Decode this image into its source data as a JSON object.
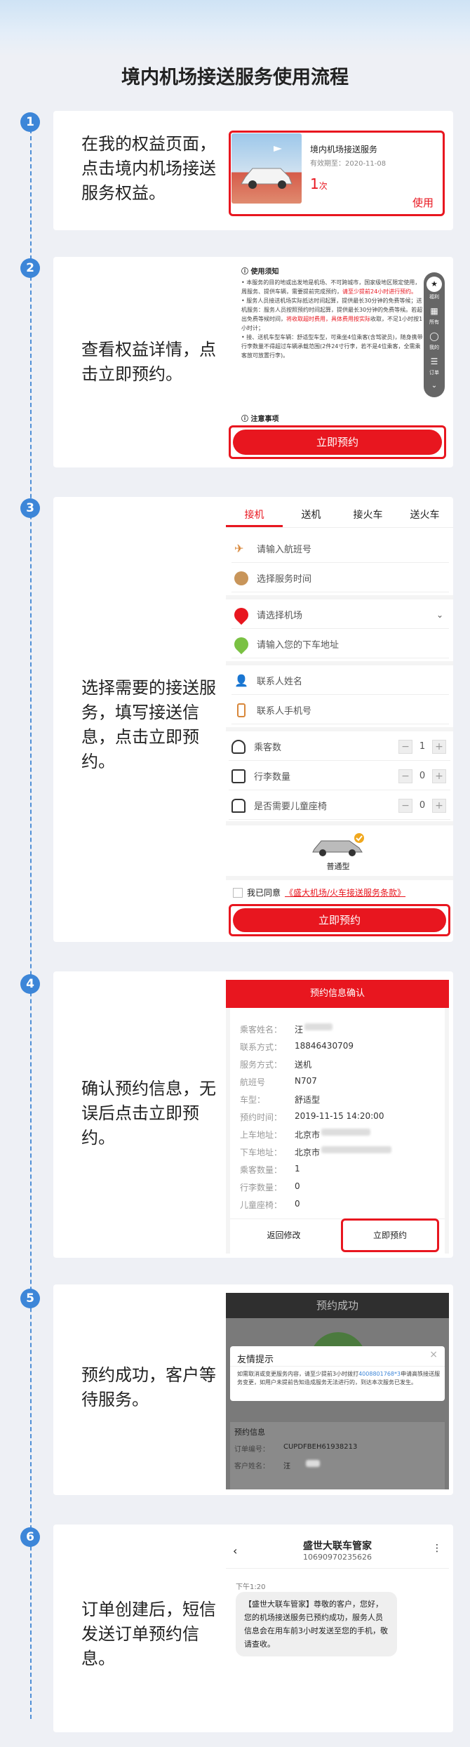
{
  "page_title": "境内机场接送服务使用流程",
  "colors": {
    "accent_red": "#e8161f",
    "step_blue": "#3d86d8"
  },
  "steps": [
    {
      "num": "1",
      "text": "在我的权益页面，点击境内机场接送服务权益。",
      "shot": {
        "title": "境内机场接送服务",
        "validity": "有效期至：2020-11-08",
        "count": "1",
        "count_unit": "次",
        "use_label": "使用"
      }
    },
    {
      "num": "2",
      "text": "查看权益详情，点击立即预约。",
      "shot": {
        "section_title": "使用须知",
        "bullet1_a": "本服务的目的地或出发地是机场、不可跨城市，国家级地区限定使用，",
        "bullet1_b": "周服务、提供车辆，需要提前完成预约，",
        "bullet1_red": "请至少提前24小时进行预约。",
        "bullet2_a": "服务人员接送机场实际抵达时间起算，提供最长30分钟的免费",
        "bullet2_b": "等候；送机服务：服务人员按照预约时间起算，提供最长30分",
        "bullet2_c": "钟的免费等候。若超出免费等候时间，",
        "bullet2_red": "将收取超时费用，具体费用按实际",
        "bullet2_d": "收取，不足1小时按1小时计；",
        "bullet3_a": "接、送机车型车辆：舒适型车型，可乘坐4位乘客(含驾驶员)，",
        "bullet3_b": "随身携带行李数量不得超过车辆承载范围(2件24寸行李，若不",
        "bullet3_c": "是4位乘客，全需乘客放可放置行李)。",
        "notice_title": "注意事项",
        "side_items": [
          "福利",
          "所有",
          "我的",
          "订单"
        ],
        "book_label": "立即预约"
      }
    },
    {
      "num": "3",
      "text": "选择需要的接送服务，填写接送信息，点击立即预约。",
      "shot": {
        "tabs": [
          "接机",
          "送机",
          "接火车",
          "送火车"
        ],
        "flight_placeholder": "请输入航班号",
        "time_placeholder": "选择服务时间",
        "airport_placeholder": "请选择机场",
        "address_placeholder": "请输入您的下车地址",
        "name_placeholder": "联系人姓名",
        "phone_placeholder": "联系人手机号",
        "passengers_label": "乘客数",
        "passengers_value": "1",
        "luggage_label": "行李数量",
        "luggage_value": "0",
        "child_seat_label": "是否需要儿童座椅",
        "child_seat_value": "0",
        "car_type": "普通型",
        "agree_text": "我已同意",
        "terms_link": "《盛大机场/火车接送服务条款》",
        "book_label": "立即预约"
      }
    },
    {
      "num": "4",
      "text": "确认预约信息，无误后点击立即预约。",
      "shot": {
        "header": "预约信息确认",
        "rows": [
          {
            "k": "乘客姓名：",
            "v": "汪"
          },
          {
            "k": "联系方式：",
            "v": "18846430709"
          },
          {
            "k": "服务方式：",
            "v": "送机"
          },
          {
            "k": "航班号",
            "v": "N707"
          },
          {
            "k": "车型：",
            "v": "舒适型"
          },
          {
            "k": "预约时间：",
            "v": "2019-11-15 14:20:00"
          },
          {
            "k": "上车地址：",
            "v": "北京市"
          },
          {
            "k": "下车地址：",
            "v": "北京市"
          },
          {
            "k": "乘客数量：",
            "v": "1"
          },
          {
            "k": "行李数量：",
            "v": "0"
          },
          {
            "k": "儿童座椅：",
            "v": "0"
          }
        ],
        "back_label": "返回修改",
        "book_label": "立即预约"
      }
    },
    {
      "num": "5",
      "text": "预约成功，客户等待服务。",
      "shot": {
        "header": "预约成功",
        "dialog_title": "友情提示",
        "dialog_text_a": "如需取消或变更服务内容，请至少提前3小时拨打",
        "dialog_phone": "4008801768*3",
        "dialog_text_b": "申请高铁接送服务变更，如用户未提前告知造成服务无法进行的，到达本次服务已发生。",
        "info_title": "预约信息",
        "order_label": "订单编号：",
        "order_no": "CUPDFBEH61938213",
        "customer_label": "客户姓名：",
        "customer_value": "汪"
      }
    },
    {
      "num": "6",
      "text": "订单创建后，短信发送订单预约信息。",
      "shot": {
        "sender": "盛世大联车管家",
        "number": "10690970235626",
        "time": "下午1:20",
        "message": "【盛世大联车管家】尊敬的客户，您好，您的机场接送服务已预约成功，服务人员信息会在用车前3小时发送至您的手机，敬请查收。"
      }
    }
  ]
}
